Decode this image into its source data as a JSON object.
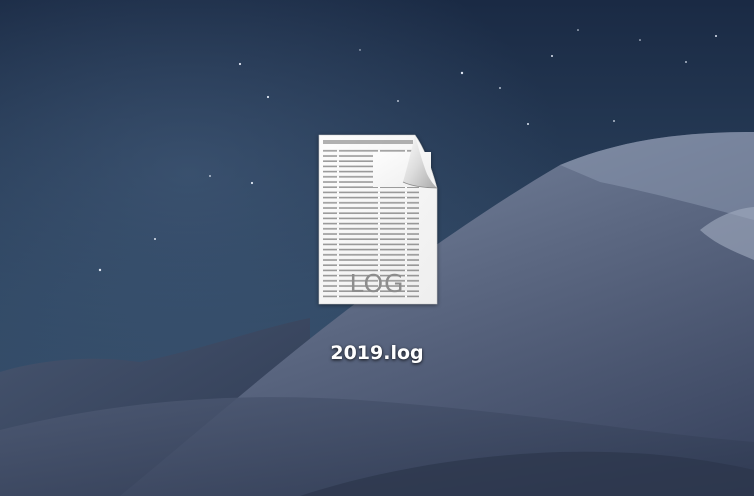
{
  "desktop": {
    "wallpaper": "desert-dunes-night",
    "icons": [
      {
        "file_name": "2019.log",
        "type_label": "LOG",
        "icon": "log-document-icon"
      }
    ]
  },
  "colors": {
    "sky_top": "#1b2b45",
    "sky_bottom": "#37506d",
    "dune_light": "#6d7a93",
    "dune_dark": "#3b465e",
    "label_text": "#ffffff"
  }
}
